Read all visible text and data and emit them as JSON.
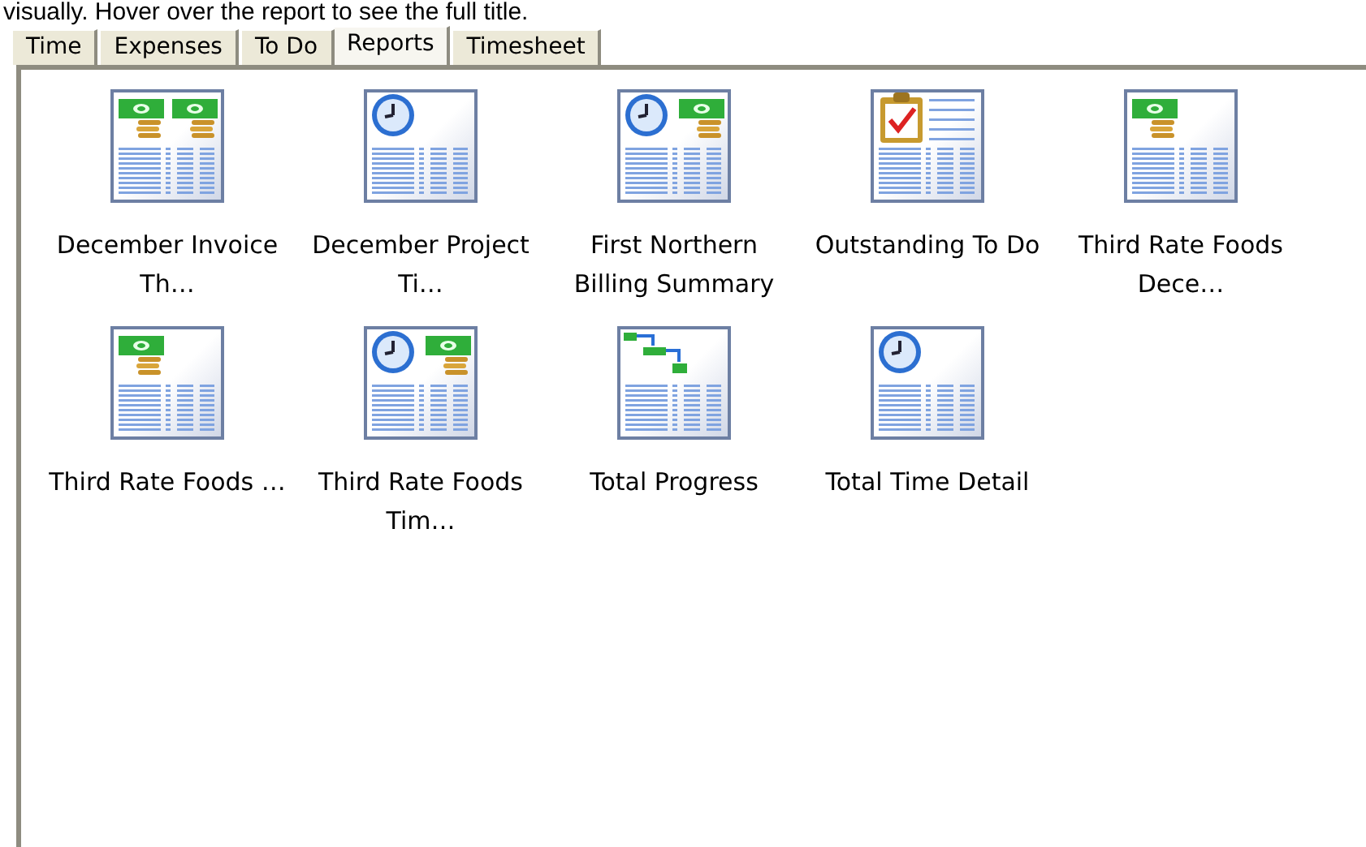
{
  "hint": "visually. Hover over the report to see the full title.",
  "tabs": [
    {
      "label": "Time",
      "selected": false
    },
    {
      "label": "Expenses",
      "selected": false
    },
    {
      "label": "To Do",
      "selected": false
    },
    {
      "label": "Reports",
      "selected": true
    },
    {
      "label": "Timesheet",
      "selected": false
    }
  ],
  "reports": [
    {
      "label": "December Invoice Th…",
      "kind": "money-money"
    },
    {
      "label": "December Project Ti…",
      "kind": "clock"
    },
    {
      "label": "First Northern Billing Summary",
      "kind": "clock-money"
    },
    {
      "label": "Outstanding To Do",
      "kind": "todo"
    },
    {
      "label": "Third Rate Foods Dece…",
      "kind": "money"
    },
    {
      "label": "Third Rate Foods …",
      "kind": "money"
    },
    {
      "label": "Third Rate Foods Tim…",
      "kind": "clock-money"
    },
    {
      "label": "Total Progress",
      "kind": "progress"
    },
    {
      "label": "Total Time Detail",
      "kind": "clock"
    }
  ]
}
